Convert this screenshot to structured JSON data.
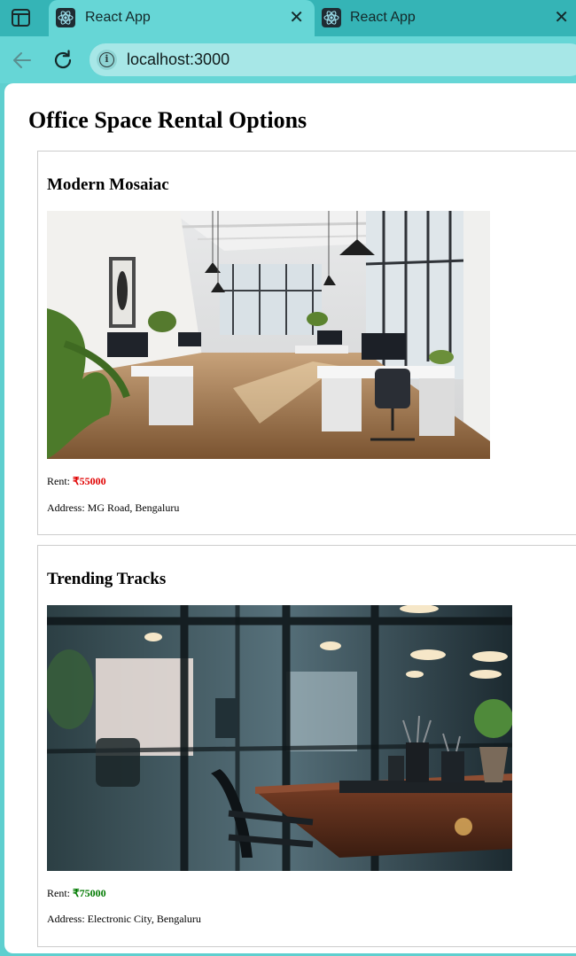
{
  "browser": {
    "tabs": [
      {
        "title": "React App",
        "active": true,
        "icon": "react-icon"
      },
      {
        "title": "React App",
        "active": false,
        "icon": "react-icon"
      }
    ],
    "url": "localhost:3000"
  },
  "page": {
    "heading": "Office Space Rental Options",
    "listings": [
      {
        "name": "Modern Mosaiac",
        "rent_label": "Rent: ",
        "rent_value": "₹55000",
        "rent_color": "#e00000",
        "address_label": "Address: ",
        "address": "MG Road, Bengaluru",
        "image": "bright-open-plan-office-photo"
      },
      {
        "name": "Trending Tracks",
        "rent_label": "Rent: ",
        "rent_value": "₹75000",
        "rent_color": "#007a00",
        "address_label": "Address: ",
        "address": "Electronic City, Bengaluru",
        "image": "dark-conference-room-photo"
      }
    ]
  }
}
